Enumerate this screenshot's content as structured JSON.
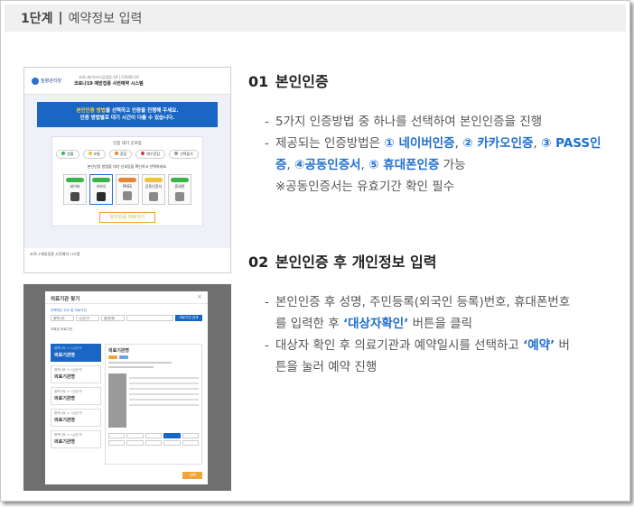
{
  "header": {
    "step": "1단계",
    "separator": "|",
    "title": "예약정보 입력"
  },
  "screenshot1": {
    "logo": "질병관리청",
    "head_sub": "코로나바이러스감염증-19 | COVID-19",
    "head_main": "코로나19 예방접종 사전예약 시스템",
    "banner_line1_hl": "본인인증 방법",
    "banner_line1_rest": "을 선택하고 인증을 진행해 주세요.",
    "banner_line2": "인증 방법별로 대기 시간이 다를 수 있습니다.",
    "legend_title": "인증 대기 신호등",
    "legend": [
      {
        "label": "원활",
        "color": "#3bb34a"
      },
      {
        "label": "보통",
        "color": "#f0c23a"
      },
      {
        "label": "혼잡",
        "color": "#e9842f"
      },
      {
        "label": "매우혼잡",
        "color": "#d23a3a"
      },
      {
        "label": "선택불가",
        "color": "#999999"
      }
    ],
    "note": "본인인증 방법을 대기 신호등을 확인하고 선택하세요.",
    "cards": [
      {
        "label": "네이버",
        "tag_color": "#3bb34a",
        "icon_color": "#4a4a4a"
      },
      {
        "label": "카카오",
        "tag_color": "#3bb34a",
        "icon_color": "#2b2b2b"
      },
      {
        "label": "PASS",
        "tag_color": "#e9842f",
        "icon_color": "#8a8a8a"
      },
      {
        "label": "공동인증서",
        "tag_color": "#f0c23a",
        "icon_color": "#8a8a8a"
      },
      {
        "label": "휴대폰",
        "tag_color": "#3bb34a",
        "icon_color": "#8a8a8a"
      }
    ],
    "button_hl": "본인인증",
    "button_rest": " 바로가기",
    "footer": "코로나 예방접종 사전예약 시스템"
  },
  "screenshot2": {
    "modal_title": "의료기관 찾기",
    "close": "×",
    "label1": "선택하신 주소 및 의료기관",
    "filter_selects": [
      "광역시도",
      "시/군/구",
      "읍/면/동"
    ],
    "search_button": "의료기관 검색",
    "label2": "조회된 의료기관",
    "items": [
      {
        "sub": "광역시도 > 시/군/구",
        "name": "의료기관명"
      },
      {
        "sub": "광역시도 > 시/군/구",
        "name": "의료기관명"
      },
      {
        "sub": "광역시도 > 시/군/구",
        "name": "의료기관명"
      },
      {
        "sub": "광역시도 > 시/군/구",
        "name": "의료기관명"
      },
      {
        "sub": "광역시도 > 시/군/구",
        "name": "의료기관명"
      }
    ],
    "detail_title": "의료기관명",
    "confirm": "선택"
  },
  "section1": {
    "number": "01",
    "title": "본인인증",
    "line1": "5가지 인증방법 중 하나를 선택하여 본인인증을 진행",
    "line2_prefix": "제공되는 인증방법은 ",
    "methods": [
      "① 네이버인증",
      "② 카카오인증",
      "③ PASS인증",
      "④공동인증서",
      "⑤ 휴대폰인증"
    ],
    "sep": ", ",
    "line2_suffix": " 가능",
    "note": "※공동인증서는 유효기간 확인 필수"
  },
  "section2": {
    "number": "02",
    "title": "본인인증 후 개인정보 입력",
    "line1_a": "본인인증 후 성명, 주민등록(외국인 등록)번호, 휴대폰번호",
    "line1_b_prefix": "를 입력한 후 ",
    "line1_b_hl": "‘대상자확인’",
    "line1_b_suffix": " 버튼을 클릭",
    "line2_a_prefix": "대상자 확인 후 의료기관과 예약일시를 선택하고 ",
    "line2_a_hl": "‘예약’",
    "line2_a_suffix": " 버",
    "line2_b": "튼을 눌러 예약 진행"
  },
  "dash": "-"
}
